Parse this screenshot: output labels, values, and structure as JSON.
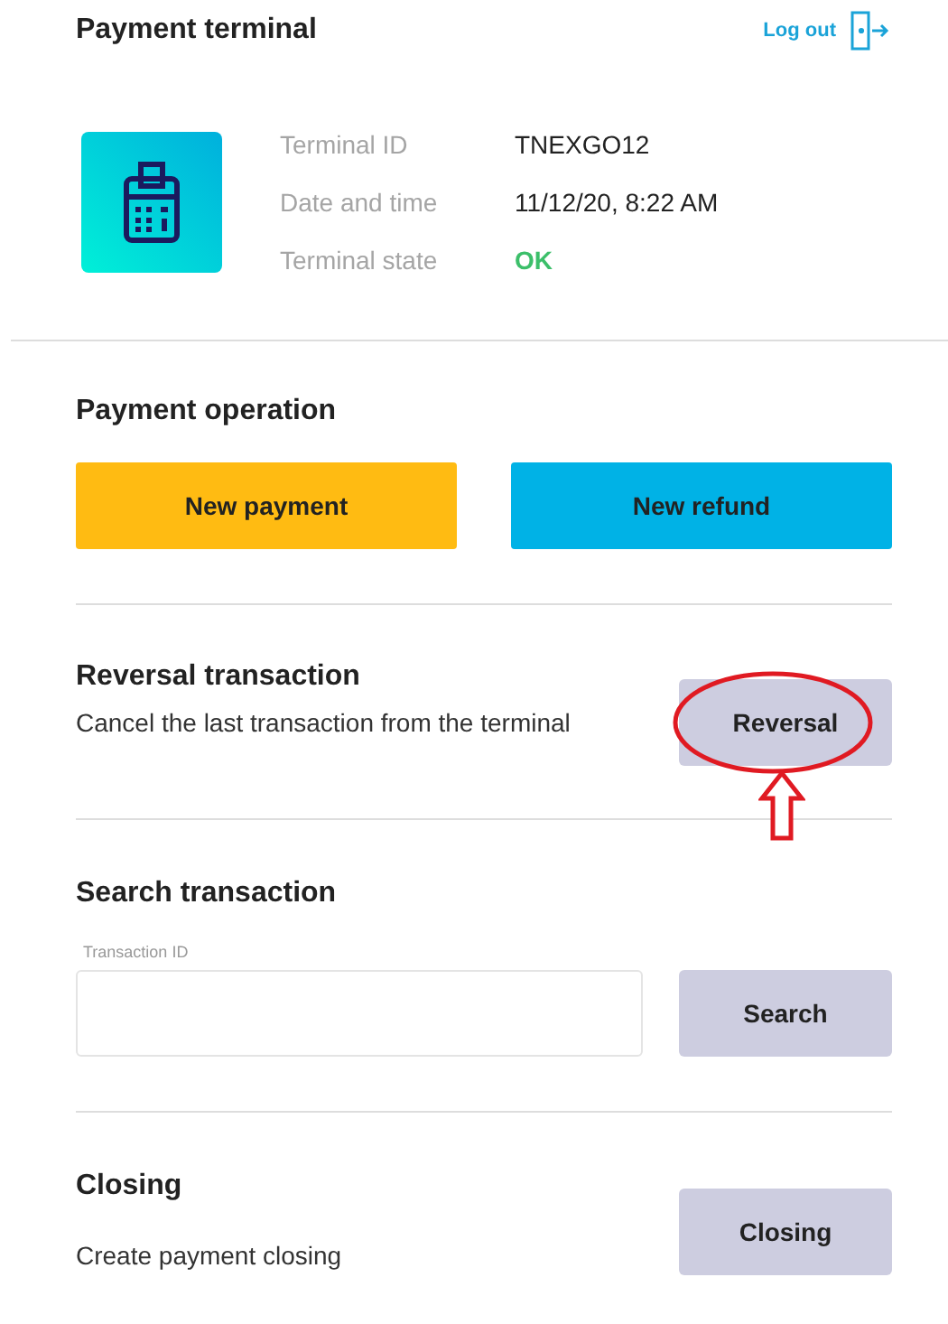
{
  "header": {
    "title": "Payment terminal",
    "logout": "Log out"
  },
  "terminal_info": [
    {
      "label": "Terminal ID",
      "value": "TNEXGO12",
      "kind": "text"
    },
    {
      "label": "Date and time",
      "value": "11/12/20, 8:22 AM",
      "kind": "text"
    },
    {
      "label": "Terminal state",
      "value": "OK",
      "kind": "status"
    }
  ],
  "payment_operation": {
    "title": "Payment operation",
    "buttons": [
      {
        "label": "New payment",
        "kind": "payment"
      },
      {
        "label": "New refund",
        "kind": "refund"
      }
    ]
  },
  "reversal": {
    "title": "Reversal transaction",
    "description": "Cancel the last transaction from the terminal",
    "button": "Reversal",
    "highlighted": true
  },
  "search": {
    "title": "Search transaction",
    "field_label": "Transaction ID",
    "button": "Search"
  },
  "closing": {
    "title": "Closing",
    "description": "Create payment closing",
    "button": "Closing"
  }
}
